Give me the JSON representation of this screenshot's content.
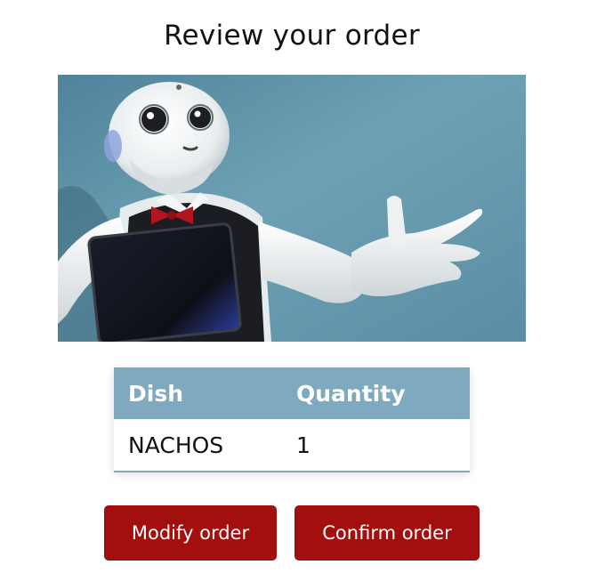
{
  "page": {
    "title": "Review your order"
  },
  "hero_image": {
    "subject": "humanoid-robot-photo",
    "background_color": "#5f95ab"
  },
  "order_table": {
    "headers": [
      "Dish",
      "Quantity"
    ],
    "rows": [
      [
        "NACHOS",
        "1"
      ]
    ],
    "header_color": "#7ea9bf"
  },
  "actions": {
    "modify_label": "Modify order",
    "confirm_label": "Confirm order",
    "button_color": "#a30e0e"
  }
}
